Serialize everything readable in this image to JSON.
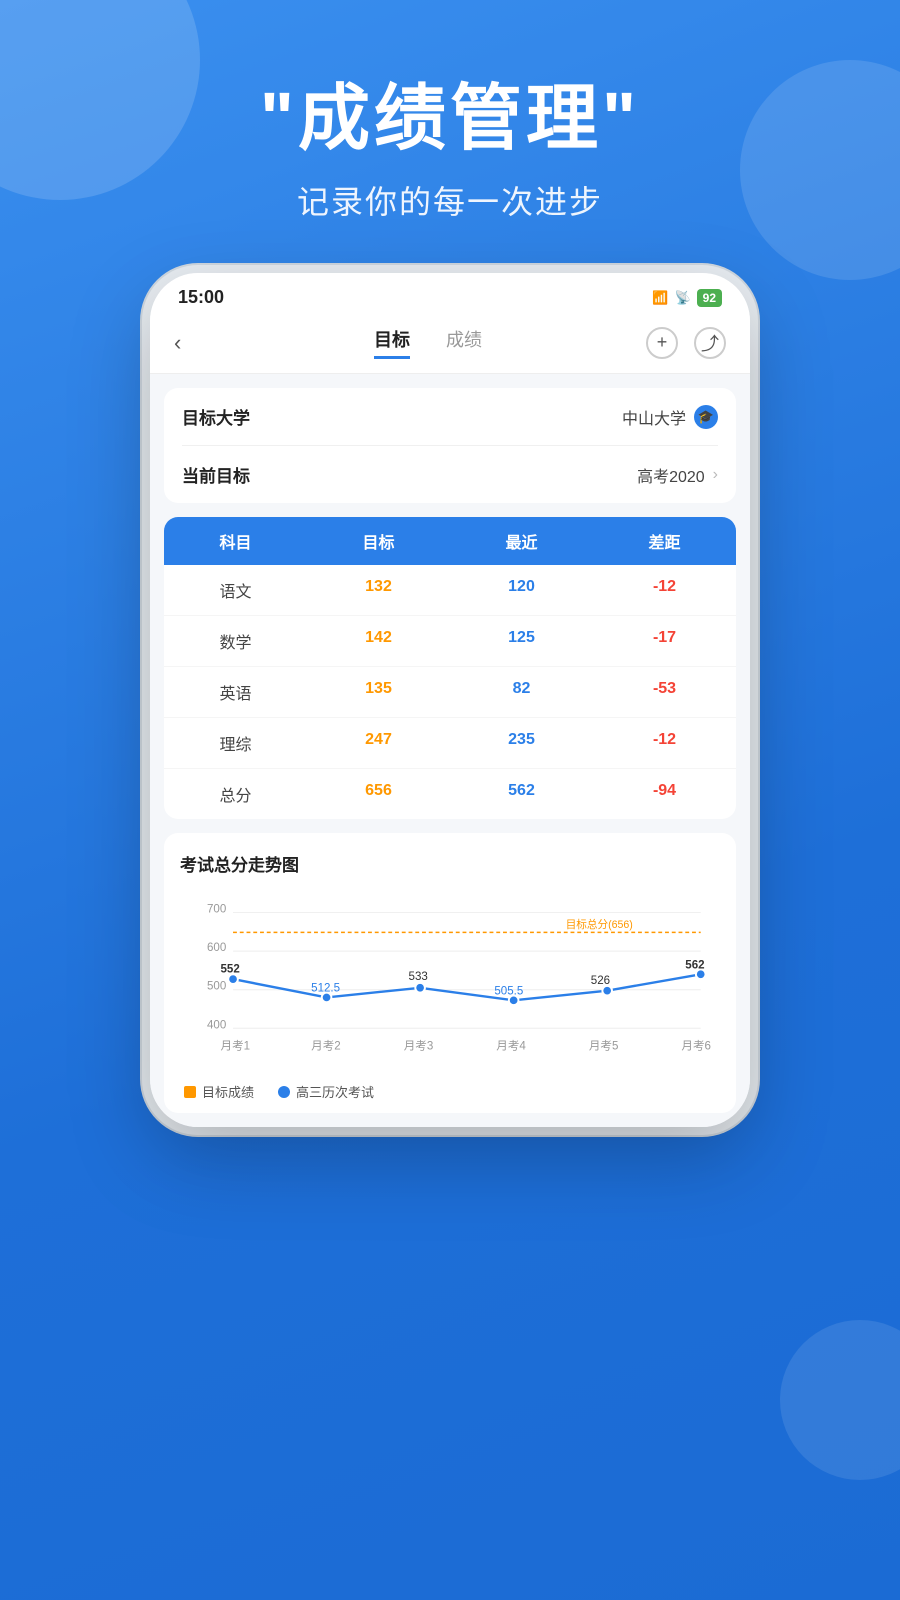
{
  "background": {
    "gradient_start": "#3A8FEF",
    "gradient_end": "#1B6BD4"
  },
  "header": {
    "title": "\"成绩管理\"",
    "subtitle": "记录你的每一次进步"
  },
  "status_bar": {
    "time": "15:00",
    "battery": "92",
    "signal_label": "HD"
  },
  "nav": {
    "back_icon": "‹",
    "tab_active": "目标",
    "tab_inactive": "成绩",
    "add_icon": "+",
    "share_icon": "⤴"
  },
  "info_rows": [
    {
      "label": "目标大学",
      "value": "中山大学",
      "has_icon": true
    },
    {
      "label": "当前目标",
      "value": "高考2020",
      "has_chevron": true
    }
  ],
  "table": {
    "headers": [
      "科目",
      "目标",
      "最近",
      "差距"
    ],
    "rows": [
      {
        "subject": "语文",
        "target": "132",
        "recent": "120",
        "diff": "-12"
      },
      {
        "subject": "数学",
        "target": "142",
        "recent": "125",
        "diff": "-17"
      },
      {
        "subject": "英语",
        "target": "135",
        "recent": "82",
        "diff": "-53"
      },
      {
        "subject": "理综",
        "target": "247",
        "recent": "235",
        "diff": "-12"
      },
      {
        "subject": "总分",
        "target": "656",
        "recent": "562",
        "diff": "-94"
      }
    ]
  },
  "chart": {
    "title": "考试总分走势图",
    "target_label": "目标总分(656)",
    "target_value": 656,
    "y_labels": [
      "700",
      "600",
      "500",
      "400"
    ],
    "x_labels": [
      "月考1",
      "月考2",
      "月考3",
      "月考4",
      "月考5",
      "月考6"
    ],
    "data_points": [
      552,
      512.5,
      533,
      505.5,
      526,
      562
    ],
    "legend": {
      "target": "目标成绩",
      "actual": "高三历次考试"
    }
  }
}
